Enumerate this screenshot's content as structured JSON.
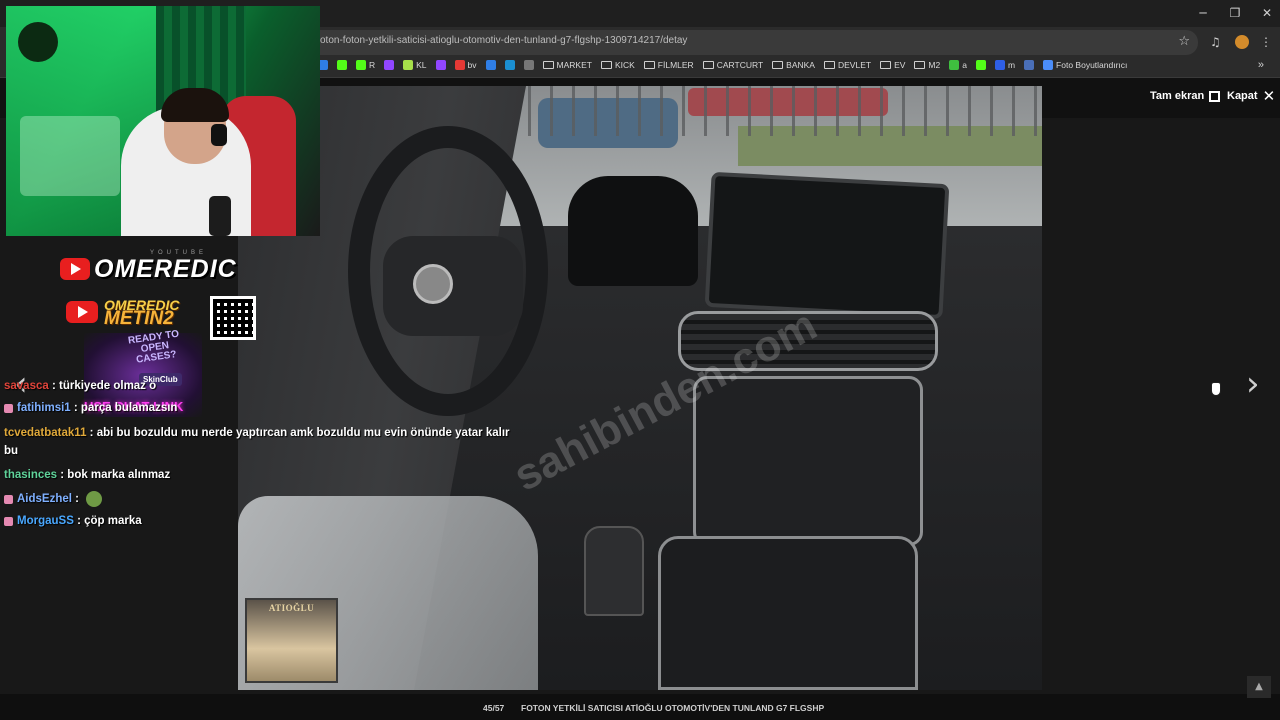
{
  "browser": {
    "url": "oton-foton-yetkili-saticisi-atioglu-otomotiv-den-tunland-g7-flgshp-1309714217/detay",
    "bookmarks": [
      {
        "label": "",
        "color": "#2f7ee6"
      },
      {
        "label": "",
        "color": "#53fc18"
      },
      {
        "label": "R",
        "color": "#53fc18"
      },
      {
        "label": "",
        "color": "#9146ff"
      },
      {
        "label": "KL",
        "color": "#a7e04a"
      },
      {
        "label": "",
        "color": "#9146ff"
      },
      {
        "label": "bv",
        "color": "#e53935"
      },
      {
        "label": "",
        "color": "#2f7ee6"
      },
      {
        "label": "",
        "color": "#1b8fd1"
      },
      {
        "label": "",
        "color": "#777777"
      },
      {
        "label": "MARKET",
        "folder": true
      },
      {
        "label": "KICK",
        "folder": true
      },
      {
        "label": "FİLMLER",
        "folder": true
      },
      {
        "label": "CARTCURT",
        "folder": true
      },
      {
        "label": "BANKA",
        "folder": true
      },
      {
        "label": "DEVLET",
        "folder": true
      },
      {
        "label": "EV",
        "folder": true
      },
      {
        "label": "M2",
        "folder": true
      },
      {
        "label": "a",
        "color": "#3fbf3f"
      },
      {
        "label": "",
        "color": "#53fc18"
      },
      {
        "label": "m",
        "color": "#2f5fe6"
      },
      {
        "label": "",
        "color": "#4a6fb8"
      },
      {
        "label": "Foto Boyutlandırıcı",
        "color": "#4b8df8"
      }
    ],
    "more_bookmarks": "»"
  },
  "viewer": {
    "fullscreen_label": "Tam ekran",
    "close_label": "Kapat",
    "counter": "45/57",
    "caption": "FOTON YETKİLİ SATICISI ATİOĞLU OTOMOTİV'DEN TUNLAND G7 FLGSHP",
    "watermark": "sahibinden.com",
    "dealer_logo": "ATIOĞLU",
    "prev_arrow": "‹",
    "next_arrow": "›"
  },
  "overlay": {
    "youtube_small": "YOUTUBE",
    "channel_name": "OMEREDIC",
    "metin_line1": "OMEREDIC",
    "metin_line2": "METIN2",
    "promo_text": "READY TO OPEN CASES?",
    "promo_logo": "SkinClub",
    "promo_link": "USE CHAT LINK"
  },
  "chat": [
    {
      "user": "savasca",
      "user_color": "#e0443a",
      "message": "türkiyede olmaz o",
      "badge": false
    },
    {
      "user": "fatihimsi1",
      "user_color": "#7fb0ff",
      "message": "parça bulamazsın",
      "badge": true
    },
    {
      "user": "tcvedatbatak11",
      "user_color": "#e0a93a",
      "message": "abi bu bozuldu mu nerde yaptırcan amk bozuldu mu evin önünde yatar kalır",
      "badge": false
    },
    {
      "user": "",
      "user_color": "#ffffff",
      "message": "bu",
      "badge": false
    },
    {
      "user": "thasinces",
      "user_color": "#5fd39a",
      "message": "bok marka alınmaz",
      "badge": false
    },
    {
      "user": "AidsEzhel",
      "user_color": "#7fb0ff",
      "message": "",
      "badge": true,
      "emote": true
    },
    {
      "user": "MorgauSS",
      "user_color": "#4aa8ff",
      "message": "çöp marka",
      "badge": true
    }
  ]
}
